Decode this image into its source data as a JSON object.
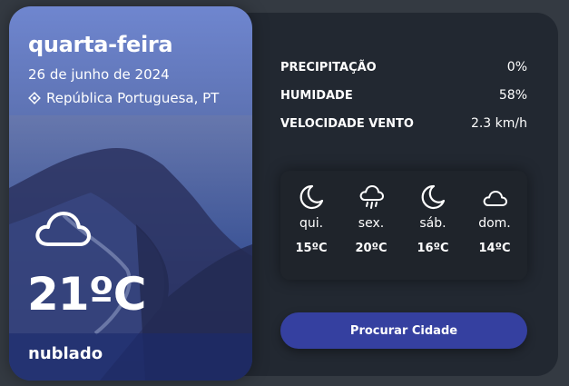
{
  "today": {
    "day_name": "quarta-feira",
    "date": "26 de junho de 2024",
    "location": "República Portuguesa, PT",
    "temperature": "21ºC",
    "description": "nublado",
    "icon": "cloud-icon"
  },
  "details": [
    {
      "title": "PRECIPITAÇÃO",
      "value": "0%"
    },
    {
      "title": "HUMIDADE",
      "value": "58%"
    },
    {
      "title": "VELOCIDADE VENTO",
      "value": "2.3 km/h"
    }
  ],
  "week": [
    {
      "day": "qui.",
      "temp": "15ºC",
      "icon": "moon-icon"
    },
    {
      "day": "sex.",
      "temp": "20ºC",
      "icon": "rain-cloud-icon"
    },
    {
      "day": "sáb.",
      "temp": "16ºC",
      "icon": "moon-icon"
    },
    {
      "day": "dom.",
      "temp": "14ºC",
      "icon": "cloud-icon"
    }
  ],
  "search_button": {
    "label": "Procurar Cidade"
  },
  "colors": {
    "page_bg": "#343a42",
    "panel_bg": "#222831",
    "week_bg": "#1f242b",
    "button_accent": "#3540a0",
    "overlay_top": "#5f78c4",
    "overlay_bottom": "#1e3074"
  }
}
